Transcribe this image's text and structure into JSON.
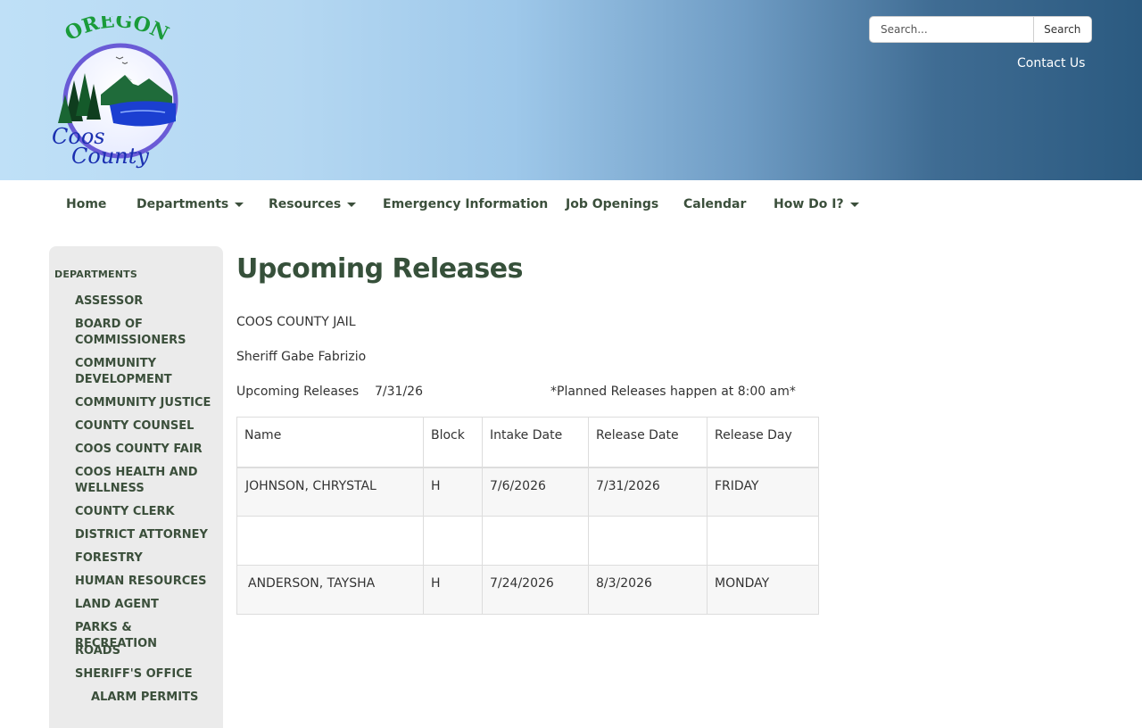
{
  "header": {
    "logo": {
      "top_text": "OREGON",
      "line1": "Coos",
      "line2": "County"
    },
    "search": {
      "placeholder": "Search...",
      "button_label": "Search"
    },
    "contact_label": "Contact Us"
  },
  "nav": {
    "items": [
      {
        "label": "Home",
        "has_dropdown": false
      },
      {
        "label": "Departments",
        "has_dropdown": true
      },
      {
        "label": "Resources",
        "has_dropdown": true
      },
      {
        "label": "Emergency Information",
        "has_dropdown": false
      },
      {
        "label": "Job Openings",
        "has_dropdown": false
      },
      {
        "label": "Calendar",
        "has_dropdown": false
      },
      {
        "label": "How Do I?",
        "has_dropdown": true
      }
    ]
  },
  "sidebar": {
    "heading": "DEPARTMENTS",
    "items": [
      "ASSESSOR",
      "BOARD OF COMMISSIONERS",
      "COMMUNITY DEVELOPMENT",
      "COMMUNITY JUSTICE",
      "COUNTY COUNSEL",
      "COOS COUNTY FAIR",
      "COOS HEALTH AND WELLNESS",
      "COUNTY CLERK",
      "DISTRICT ATTORNEY",
      "FORESTRY",
      "HUMAN RESOURCES",
      "LAND AGENT",
      "PARKS & RECREATION",
      "ROADS",
      "SHERIFF'S OFFICE"
    ],
    "subitems": [
      "ALARM PERMITS"
    ]
  },
  "main": {
    "title": "Upcoming Releases",
    "jail_name": "COOS COUNTY JAIL",
    "sheriff": "Sheriff Gabe Fabrizio",
    "releases_label": "Upcoming Releases",
    "releases_date": "7/31/26",
    "note": "*Planned Releases happen at 8:00 am*",
    "table": {
      "headers": [
        "Name",
        "Block",
        "Intake Date",
        "Release Date",
        "Release Day"
      ],
      "rows": [
        [
          "JOHNSON, CHRYSTAL",
          "H",
          "7/6/2026",
          "7/31/2026",
          "FRIDAY"
        ],
        [
          "",
          "",
          "",
          "",
          ""
        ],
        [
          "ANDERSON, TAYSHA",
          "H",
          "7/24/2026",
          "8/3/2026",
          "MONDAY"
        ]
      ]
    }
  },
  "colors": {
    "nav_text": "#3b4f3b",
    "title": "#36503a",
    "header_light": "#bfe0f7",
    "header_dark": "#2b5a80",
    "sidebar_bg": "#ebebeb"
  }
}
